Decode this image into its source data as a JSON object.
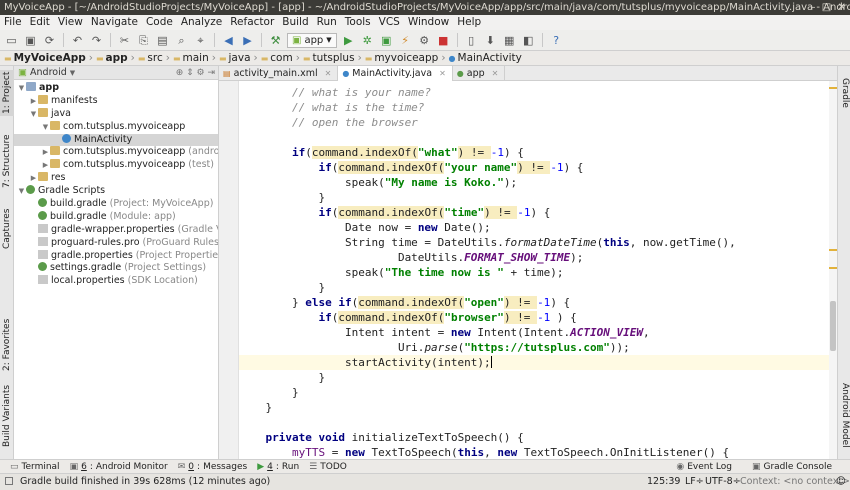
{
  "window": {
    "title": "MyVoiceApp - [~/AndroidStudioProjects/MyVoiceApp] - [app] - ~/AndroidStudioProjects/MyVoiceApp/app/src/main/java/com/tutsplus/myvoiceapp/MainActivity.java - Android Stu"
  },
  "menu": [
    "File",
    "Edit",
    "View",
    "Navigate",
    "Code",
    "Analyze",
    "Refactor",
    "Build",
    "Run",
    "Tools",
    "VCS",
    "Window",
    "Help"
  ],
  "toolbar": {
    "run_config": "app"
  },
  "breadcrumbs": [
    "MyVoiceApp",
    "app",
    "src",
    "main",
    "java",
    "com",
    "tutsplus",
    "myvoiceapp",
    "MainActivity"
  ],
  "left_tools": [
    "1: Project",
    "7: Structure",
    "Captures",
    "2: Favorites",
    "Build Variants"
  ],
  "right_tools": [
    "Gradle",
    "Android Model"
  ],
  "project": {
    "view_mode": "Android",
    "tree": [
      {
        "label": "app",
        "hint": "",
        "depth": 0,
        "arrow": "open",
        "icon": "foldb",
        "bold": true
      },
      {
        "label": "manifests",
        "hint": "",
        "depth": 1,
        "arrow": "closed",
        "icon": "fold"
      },
      {
        "label": "java",
        "hint": "",
        "depth": 1,
        "arrow": "open",
        "icon": "fold"
      },
      {
        "label": "com.tutsplus.myvoiceapp",
        "hint": "",
        "depth": 2,
        "arrow": "open",
        "icon": "fold"
      },
      {
        "label": "MainActivity",
        "hint": "",
        "depth": 3,
        "arrow": "",
        "icon": "cls",
        "sel": true
      },
      {
        "label": "com.tutsplus.myvoiceapp",
        "hint": "(androidTe",
        "depth": 2,
        "arrow": "closed",
        "icon": "fold"
      },
      {
        "label": "com.tutsplus.myvoiceapp",
        "hint": "(test)",
        "depth": 2,
        "arrow": "closed",
        "icon": "fold"
      },
      {
        "label": "res",
        "hint": "",
        "depth": 1,
        "arrow": "closed",
        "icon": "fold"
      },
      {
        "label": "Gradle Scripts",
        "hint": "",
        "depth": 0,
        "arrow": "open",
        "icon": "grad"
      },
      {
        "label": "build.gradle",
        "hint": "(Project: MyVoiceApp)",
        "depth": 1,
        "arrow": "",
        "icon": "grad"
      },
      {
        "label": "build.gradle",
        "hint": "(Module: app)",
        "depth": 1,
        "arrow": "",
        "icon": "grad"
      },
      {
        "label": "gradle-wrapper.properties",
        "hint": "(Gradle Vers",
        "depth": 1,
        "arrow": "",
        "icon": "file"
      },
      {
        "label": "proguard-rules.pro",
        "hint": "(ProGuard Rules for",
        "depth": 1,
        "arrow": "",
        "icon": "file"
      },
      {
        "label": "gradle.properties",
        "hint": "(Project Properties)",
        "depth": 1,
        "arrow": "",
        "icon": "file"
      },
      {
        "label": "settings.gradle",
        "hint": "(Project Settings)",
        "depth": 1,
        "arrow": "",
        "icon": "grad"
      },
      {
        "label": "local.properties",
        "hint": "(SDK Location)",
        "depth": 1,
        "arrow": "",
        "icon": "file"
      }
    ]
  },
  "tabs": [
    {
      "label": "activity_main.xml",
      "active": false
    },
    {
      "label": "MainActivity.java",
      "active": true
    },
    {
      "label": "app",
      "active": false
    }
  ],
  "code_lines": [
    [
      [
        "cm",
        "        // what is your name?"
      ]
    ],
    [
      [
        "cm",
        "        // what is the time?"
      ]
    ],
    [
      [
        "cm",
        "        // open the browser"
      ]
    ],
    [
      [
        "",
        ""
      ]
    ],
    [
      [
        "",
        "        "
      ],
      [
        "kw",
        "if"
      ],
      [
        "",
        "("
      ],
      [
        "hl",
        "command.indexOf("
      ],
      [
        "st",
        "\"what\""
      ],
      [
        "hl",
        ") != "
      ],
      [
        "nm",
        "-1"
      ],
      [
        "",
        ") {"
      ]
    ],
    [
      [
        "",
        "            "
      ],
      [
        "kw",
        "if"
      ],
      [
        "",
        "("
      ],
      [
        "hl",
        "command.indexOf("
      ],
      [
        "st",
        "\"your name\""
      ],
      [
        "hl",
        ") != "
      ],
      [
        "nm",
        "-1"
      ],
      [
        "",
        ") {"
      ]
    ],
    [
      [
        "",
        "                speak("
      ],
      [
        "st",
        "\"My name is Koko.\""
      ],
      [
        "",
        ");"
      ]
    ],
    [
      [
        "",
        "            }"
      ]
    ],
    [
      [
        "",
        "            "
      ],
      [
        "kw",
        "if"
      ],
      [
        "",
        "("
      ],
      [
        "hl",
        "command.indexOf("
      ],
      [
        "st",
        "\"time\""
      ],
      [
        "hl",
        ") != "
      ],
      [
        "nm",
        "-1"
      ],
      [
        "",
        ") {"
      ]
    ],
    [
      [
        "",
        "                Date now = "
      ],
      [
        "kw",
        "new"
      ],
      [
        "",
        " Date();"
      ]
    ],
    [
      [
        "",
        "                String time = DateUtils."
      ],
      [
        "it",
        "formatDateTime"
      ],
      [
        "",
        "("
      ],
      [
        "kw",
        "this"
      ],
      [
        "",
        ", now.getTime(),"
      ]
    ],
    [
      [
        "",
        "                        DateUtils."
      ],
      [
        "cn",
        "FORMAT_SHOW_TIME"
      ],
      [
        "",
        ");"
      ]
    ],
    [
      [
        "",
        "                speak("
      ],
      [
        "st",
        "\"The time now is \""
      ],
      [
        "",
        " + time);"
      ]
    ],
    [
      [
        "",
        "            }"
      ]
    ],
    [
      [
        "",
        "        } "
      ],
      [
        "kw",
        "else if"
      ],
      [
        "",
        "("
      ],
      [
        "hl",
        "command.indexOf("
      ],
      [
        "st",
        "\"open\""
      ],
      [
        "hl",
        ") != "
      ],
      [
        "nm",
        "-1"
      ],
      [
        "",
        ") {"
      ]
    ],
    [
      [
        "",
        "            "
      ],
      [
        "kw",
        "if"
      ],
      [
        "",
        "("
      ],
      [
        "hl",
        "command.indexOf("
      ],
      [
        "st",
        "\"browser\""
      ],
      [
        "hl",
        ") != "
      ],
      [
        "nm",
        "-1"
      ],
      [
        "",
        " ) {"
      ]
    ],
    [
      [
        "",
        "                Intent intent = "
      ],
      [
        "kw",
        "new"
      ],
      [
        "",
        " Intent(Intent."
      ],
      [
        "cn",
        "ACTION_VIEW"
      ],
      [
        "",
        ","
      ]
    ],
    [
      [
        "",
        "                        Uri."
      ],
      [
        "it",
        "parse"
      ],
      [
        "",
        "("
      ],
      [
        "st",
        "\"https://tutsplus.com\""
      ],
      [
        "",
        "));"
      ]
    ],
    [
      [
        "",
        "                startActivity(intent);"
      ],
      [
        "caret",
        ""
      ]
    ],
    [
      [
        "",
        "            }"
      ]
    ],
    [
      [
        "",
        "        }"
      ]
    ],
    [
      [
        "",
        "    }"
      ]
    ],
    [
      [
        "",
        ""
      ]
    ],
    [
      [
        "",
        "    "
      ],
      [
        "kw",
        "private void"
      ],
      [
        "",
        " initializeTextToSpeech() {"
      ]
    ],
    [
      [
        "",
        "        "
      ],
      [
        "pf",
        "myTTS"
      ],
      [
        "",
        " = "
      ],
      [
        "kw",
        "new"
      ],
      [
        "",
        " TextToSpeech("
      ],
      [
        "kw",
        "this"
      ],
      [
        "",
        ", "
      ],
      [
        "kw",
        "new"
      ],
      [
        "",
        " TextToSpeech.OnInitListener() {"
      ]
    ]
  ],
  "bottom_tools": [
    {
      "label": "Terminal",
      "num": ""
    },
    {
      "label": "Android Monitor",
      "num": "6"
    },
    {
      "label": "Messages",
      "num": "0"
    },
    {
      "label": "Run",
      "num": "4"
    },
    {
      "label": "TODO",
      "num": ""
    }
  ],
  "bottom_right_tools": [
    "Event Log",
    "Gradle Console"
  ],
  "status": {
    "message": "Gradle build finished in 39s 628ms (12 minutes ago)",
    "position": "125:39",
    "line_sep": "LF÷",
    "encoding": "UTF-8÷",
    "context": "Context: <no context>"
  },
  "colors": {
    "keyword": "#000080",
    "string": "#008000",
    "highlight": "#f8edc0",
    "comment": "#8c8c8c"
  }
}
